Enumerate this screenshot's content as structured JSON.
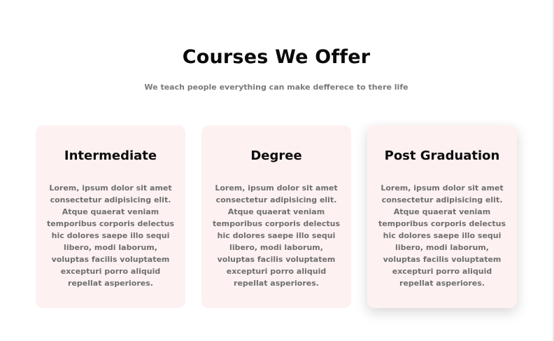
{
  "heading": {
    "title": "Courses We Offer",
    "subtitle": "We teach people everything can make defferece to there life"
  },
  "courses": [
    {
      "title": "Intermediate",
      "text": "Lorem, ipsum dolor sit amet consectetur adipisicing elit. Atque quaerat veniam temporibus corporis delectus hic dolores saepe illo sequi libero, modi laborum, voluptas facilis voluptatem excepturi porro aliquid repellat asperiores."
    },
    {
      "title": "Degree",
      "text": "Lorem, ipsum dolor sit amet consectetur adipisicing elit. Atque quaerat veniam temporibus corporis delectus hic dolores saepe illo sequi libero, modi laborum, voluptas facilis voluptatem excepturi porro aliquid repellat asperiores."
    },
    {
      "title": "Post Graduation",
      "text": "Lorem, ipsum dolor sit amet consectetur adipisicing elit. Atque quaerat veniam temporibus corporis delectus hic dolores saepe illo sequi libero, modi laborum, voluptas facilis voluptatem excepturi porro aliquid repellat asperiores."
    }
  ],
  "colors": {
    "card_background": "#fdf1f2",
    "title_text": "#0a0a0a",
    "body_text": "#6f6f6f"
  }
}
